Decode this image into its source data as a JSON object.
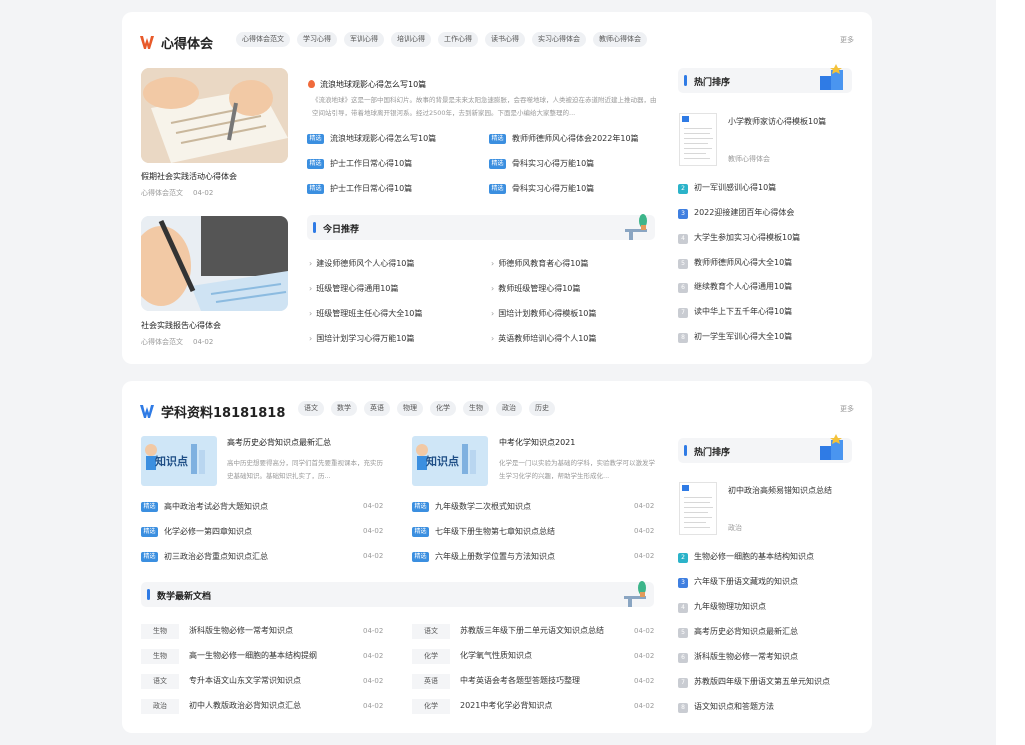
{
  "panel1": {
    "title": "心得体会",
    "tags": [
      "心得体会范文",
      "学习心得",
      "军训心得",
      "培训心得",
      "工作心得",
      "读书心得",
      "实习心得体会",
      "教师心得体会"
    ],
    "more": "更多",
    "cards": [
      {
        "caption": "假期社会实践活动心得体会",
        "category": "心得体会范文",
        "date": "04-02"
      },
      {
        "caption": "社会实践报告心得体会",
        "category": "心得体会范文",
        "date": "04-02"
      }
    ],
    "featured": {
      "title": "流浪地球观影心得怎么写10篇",
      "summary": "《流浪地球》这是一部中国科幻片。故事的背景是未来太阳急速膨胀，会吞噬地球，人类被迫在赤道附近建上推动器，由空间站引导，带着地球离开银河系。经过2500年，去到新家园。下面是小编给大家整理的..."
    },
    "badge": "精选",
    "picks": [
      "流浪地球观影心得怎么写10篇",
      "教师师德师风心得体会2022年10篇",
      "护士工作日常心得10篇",
      "骨科实习心得万能10篇",
      "护士工作日常心得10篇",
      "骨科实习心得万能10篇"
    ],
    "today_title": "今日推荐",
    "today": [
      "建设师德师风个人心得10篇",
      "师德师风教育者心得10篇",
      "班级管理心得通用10篇",
      "教师班级管理心得10篇",
      "班级管理班主任心得大全10篇",
      "国培计划教师心得模板10篇",
      "国培计划学习心得万能10篇",
      "英语教师培训心得个人10篇"
    ],
    "hot_title": "热门排序",
    "hot_top": {
      "title": "小学教师家访心得模板10篇",
      "category": "教师心得体会"
    },
    "hot_list": [
      {
        "n": "2",
        "t": "初一军训感训心得10篇"
      },
      {
        "n": "3",
        "t": "2022迎接建团百年心得体会"
      },
      {
        "n": "4",
        "t": "大学生参加实习心得模板10篇"
      },
      {
        "n": "5",
        "t": "教师师德师风心得大全10篇"
      },
      {
        "n": "6",
        "t": "继续教育个人心得通用10篇"
      },
      {
        "n": "7",
        "t": "读中华上下五千年心得10篇"
      },
      {
        "n": "8",
        "t": "初一学生军训心得大全10篇"
      }
    ]
  },
  "panel2": {
    "title": "学科资料18181818",
    "tags": [
      "语文",
      "数学",
      "英语",
      "物理",
      "化学",
      "生物",
      "政治",
      "历史"
    ],
    "more": "更多",
    "features": [
      {
        "thumb_text": "知识点",
        "title": "高考历史必背知识点最新汇总",
        "summary": "高中历史想要得高分，同学们首先要重视课本，充实历史基础知识。基础知识扎实了，历..."
      },
      {
        "thumb_text": "知识点",
        "title": "中考化学知识点2021",
        "summary": "化学是一门以实验为基础的学科，实验教学可以激发学生学习化学的兴趣，帮助学生形成化..."
      }
    ],
    "badge": "精选",
    "picks_left": [
      {
        "t": "高中政治考试必背大题知识点",
        "d": "04-02"
      },
      {
        "t": "化学必修一第四章知识点",
        "d": "04-02"
      },
      {
        "t": "初三政治必背重点知识点汇总",
        "d": "04-02"
      }
    ],
    "picks_right": [
      {
        "t": "九年级数学二次根式知识点",
        "d": "04-02"
      },
      {
        "t": "七年级下册生物第七章知识点总结",
        "d": "04-02"
      },
      {
        "t": "六年级上册数学位置与方法知识点",
        "d": "04-02"
      }
    ],
    "math_title": "数学最新文档",
    "math_left": [
      {
        "s": "生物",
        "t": "浙科版生物必修一常考知识点",
        "d": "04-02"
      },
      {
        "s": "生物",
        "t": "高一生物必修一细胞的基本结构提纲",
        "d": "04-02"
      },
      {
        "s": "语文",
        "t": "专升本语文山东文学常识知识点",
        "d": "04-02"
      },
      {
        "s": "政治",
        "t": "初中人教版政治必背知识点汇总",
        "d": "04-02"
      }
    ],
    "math_right": [
      {
        "s": "语文",
        "t": "苏教版三年级下册二单元语文知识点总结",
        "d": "04-02"
      },
      {
        "s": "化学",
        "t": "化学氧气性质知识点",
        "d": "04-02"
      },
      {
        "s": "英语",
        "t": "中考英语会考各题型答题技巧整理",
        "d": "04-02"
      },
      {
        "s": "化学",
        "t": "2021中考化学必背知识点",
        "d": "04-02"
      }
    ],
    "hot_title": "热门排序",
    "hot_top": {
      "title": "初中政治高频易错知识点总结",
      "category": "政治"
    },
    "hot_list": [
      {
        "n": "2",
        "t": "生物必修一细胞的基本结构知识点"
      },
      {
        "n": "3",
        "t": "六年级下册语文藏戏的知识点"
      },
      {
        "n": "4",
        "t": "九年级物理功知识点"
      },
      {
        "n": "5",
        "t": "高考历史必背知识点最新汇总"
      },
      {
        "n": "6",
        "t": "浙科版生物必修一常考知识点"
      },
      {
        "n": "7",
        "t": "苏教版四年级下册语文第五单元知识点"
      },
      {
        "n": "8",
        "t": "语文知识点和答题方法"
      }
    ]
  },
  "colors": {
    "accent": "#2f7be5",
    "badge": "#3b8fe0",
    "rank_top2": "#2bb3c9",
    "rank_top3": "#3f7fe0",
    "rank_rest": "#c9ccd2"
  }
}
